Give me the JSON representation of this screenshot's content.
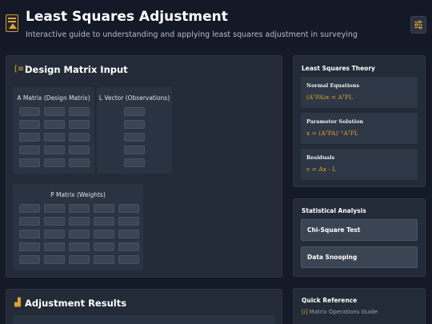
{
  "header": {
    "title": "Least Squares Adjustment",
    "subtitle": "Interactive guide to understanding and applying least squares adjustment in surveying",
    "settings_icon": "sliders-icon"
  },
  "design_matrix": {
    "title": "Design Matrix Input",
    "icon": "matrix-icon",
    "a_label": "A Matrix (Design Matrix)",
    "l_label": "L Vector (Observations)",
    "p_label": "P Matrix (Weights)"
  },
  "results": {
    "title": "Adjustment Results",
    "icon": "chart-icon"
  },
  "theory": {
    "title": "Least Squares Theory",
    "cards": [
      {
        "heading": "Normal Equations",
        "equation": "(AᵀPA)x = AᵀPL"
      },
      {
        "heading": "Parameter Solution",
        "equation": "x = (AᵀPA)⁻¹AᵀPL"
      },
      {
        "heading": "Residuals",
        "equation": "v = Ax - L"
      }
    ]
  },
  "stats": {
    "title": "Statistical Analysis",
    "buttons": [
      "Chi-Square Test",
      "Data Snooping"
    ]
  },
  "quick_reference": {
    "title": "Quick Reference",
    "links": [
      "Matrix Operations Guide"
    ]
  },
  "colors": {
    "accent": "#e0a32e",
    "background": "#141a26",
    "panel": "#232b38"
  }
}
